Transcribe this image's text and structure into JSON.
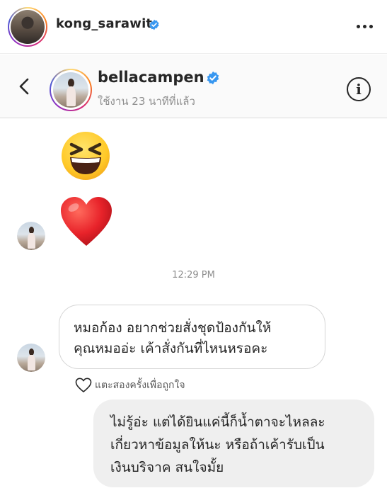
{
  "post_header": {
    "username": "kong_sarawit",
    "verified": true,
    "more_icon": "more-horizontal-icon"
  },
  "conversation": {
    "back_icon": "chevron-left-icon",
    "username": "bellacampen",
    "verified": true,
    "status": "ใช้งาน 23 นาทีที่แล้ว",
    "info_icon": "info-icon",
    "info_glyph": "i"
  },
  "messages": {
    "emoji_1": "😆",
    "emoji_1_name": "grinning-squinting-face-emoji",
    "emoji_2": "❤️",
    "emoji_2_name": "red-heart-emoji",
    "timestamp": "12:29 PM",
    "incoming": {
      "line_1": "หมอก้อง อยากช่วยสั่งชุดป้องกันให้",
      "line_2": "คุณหมออ่ะ เค้าสั่งกันที่ไหนหรอคะ"
    },
    "like_hint": "แตะสองครั้งเพื่อถูกใจ",
    "outgoing": {
      "line_1": "ไม่รู้อ่ะ แต่ได้ยินแค่นี้ก็น้ำตาจะไหลละ",
      "line_2": "เกี่ยวหาข้อมูลให้นะ หรือถ้าเค้ารับเป็น",
      "line_3": "เงินบริจาค สนใจมั้ย"
    }
  },
  "colors": {
    "verified_blue": "#3897f0",
    "secondary_text": "#8e8e8e",
    "outgoing_bubble": "#efefef",
    "header_bg": "#fafafa"
  }
}
